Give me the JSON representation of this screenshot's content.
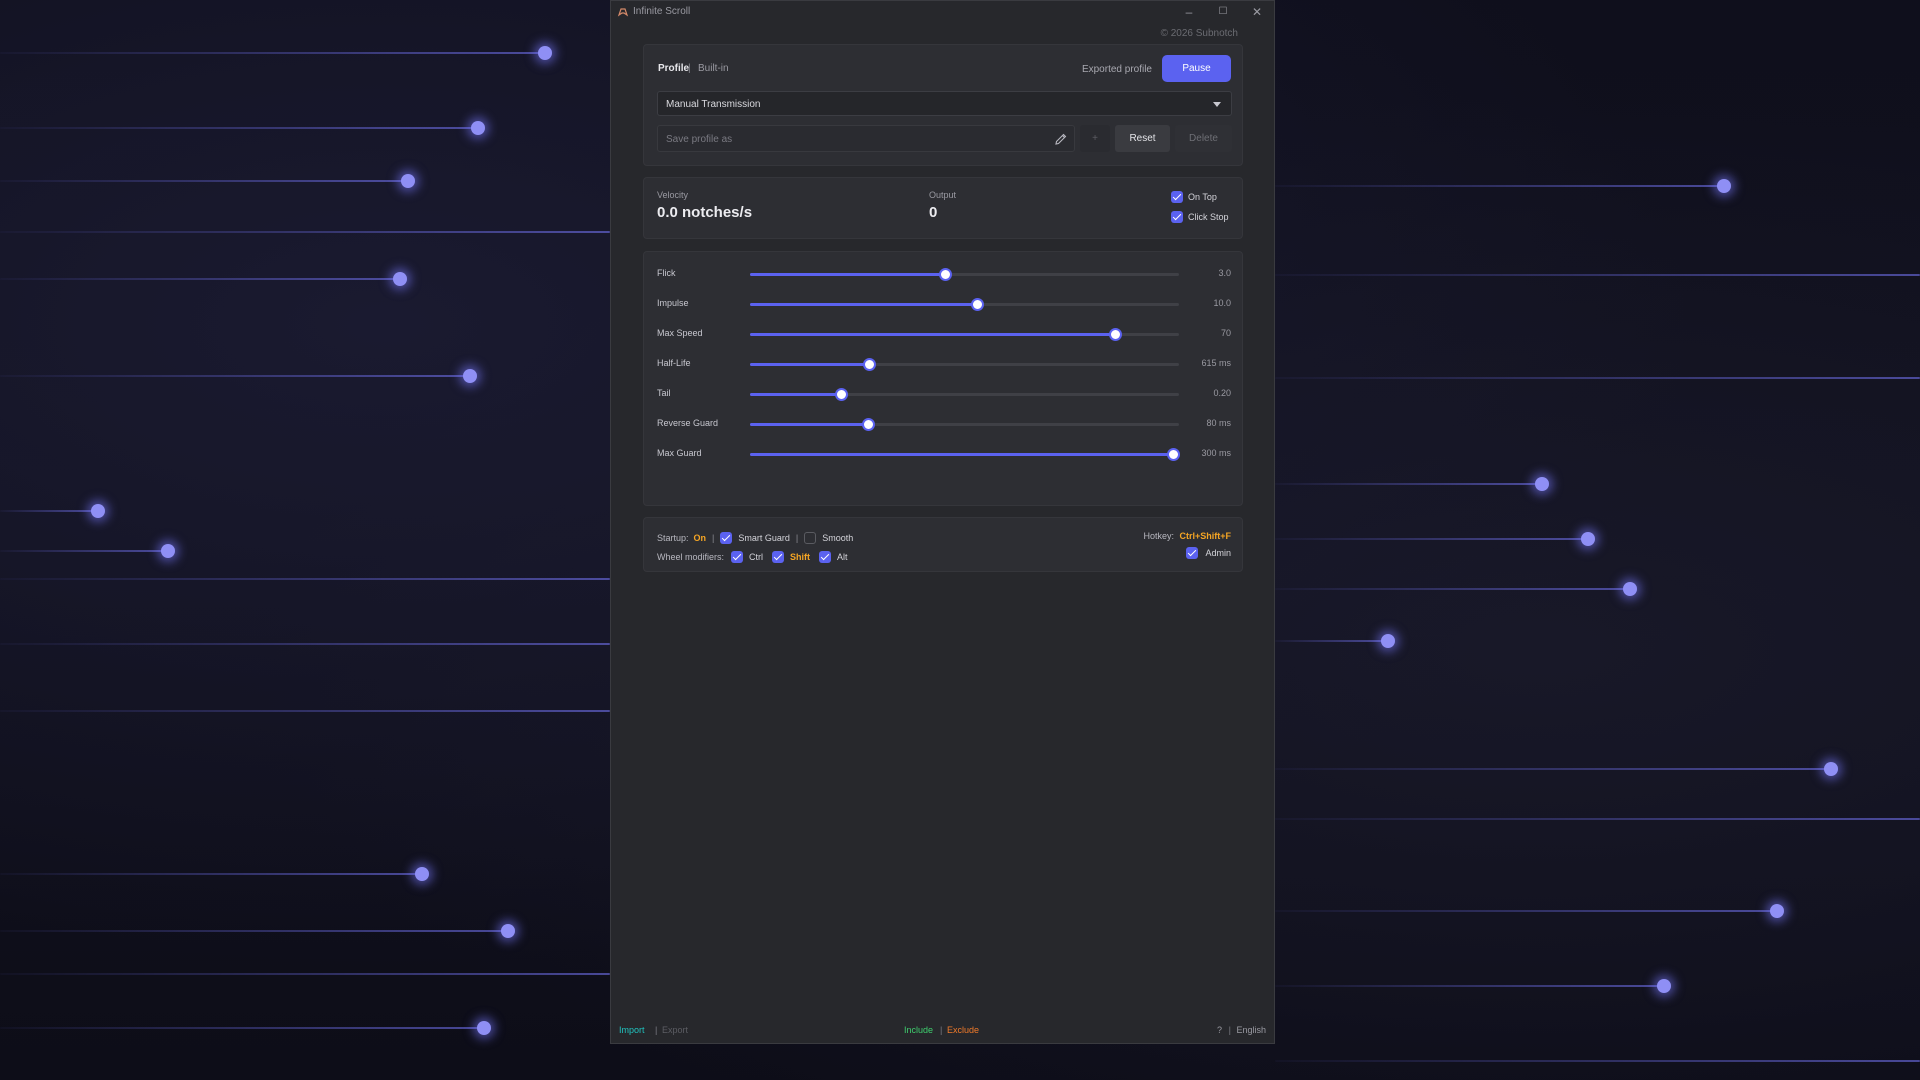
{
  "window": {
    "title": "Infinite Scroll",
    "copyright": "© 2026 Subnotch",
    "controls": {
      "minimize": "–",
      "maximize": "☐",
      "close": "✕"
    }
  },
  "profile": {
    "tab_profile": "Profile",
    "tab_separator": "|",
    "tab_builtin": "Built-in",
    "exported_label": "Exported profile",
    "pause_label": "Pause",
    "selected_profile": "Manual Transmission",
    "save_placeholder": "Save profile as",
    "plus_label": "+",
    "reset_label": "Reset",
    "delete_label": "Delete"
  },
  "stats": {
    "velocity_label": "Velocity",
    "velocity_value": "0.0 notches/s",
    "output_label": "Output",
    "output_value": "0",
    "on_top_label": "On Top",
    "on_top_checked": true,
    "click_stop_label": "Click Stop",
    "click_stop_checked": true
  },
  "sliders": [
    {
      "label": "Flick",
      "value": "3.0",
      "fraction": 0.455
    },
    {
      "label": "Impulse",
      "value": "10.0",
      "fraction": 0.528
    },
    {
      "label": "Max Speed",
      "value": "70",
      "fraction": 0.85
    },
    {
      "label": "Half-Life",
      "value": "615 ms",
      "fraction": 0.278
    },
    {
      "label": "Tail",
      "value": "0.20",
      "fraction": 0.211
    },
    {
      "label": "Reverse Guard",
      "value": "80 ms",
      "fraction": 0.275
    },
    {
      "label": "Max Guard",
      "value": "300 ms",
      "fraction": 0.985
    }
  ],
  "options": {
    "startup_label": "Startup:",
    "startup_value": "On",
    "separator": "|",
    "smart_guard_label": "Smart Guard",
    "smart_guard_checked": true,
    "smooth_label": "Smooth",
    "smooth_checked": false,
    "hotkey_label": "Hotkey:",
    "hotkey_value": "Ctrl+Shift+F",
    "wheel_modifiers_label": "Wheel modifiers:",
    "ctrl_label": "Ctrl",
    "shift_label": "Shift",
    "alt_label": "Alt",
    "admin_label": "Admin"
  },
  "footer": {
    "import_label": "Import",
    "separator": "|",
    "export_label": "Export",
    "include_label": "Include",
    "exclude_label": "Exclude",
    "help_label": "?",
    "language_label": "English"
  },
  "colors": {
    "accent": "#5b62f0",
    "startup_highlight": "#f5a524",
    "import": "#20c4c0",
    "include": "#3fcf6e",
    "exclude": "#f07a2a"
  },
  "icons": {
    "app": "gamepad-icon",
    "edit": "pencil-icon",
    "dropdown": "chevron-down-icon"
  }
}
